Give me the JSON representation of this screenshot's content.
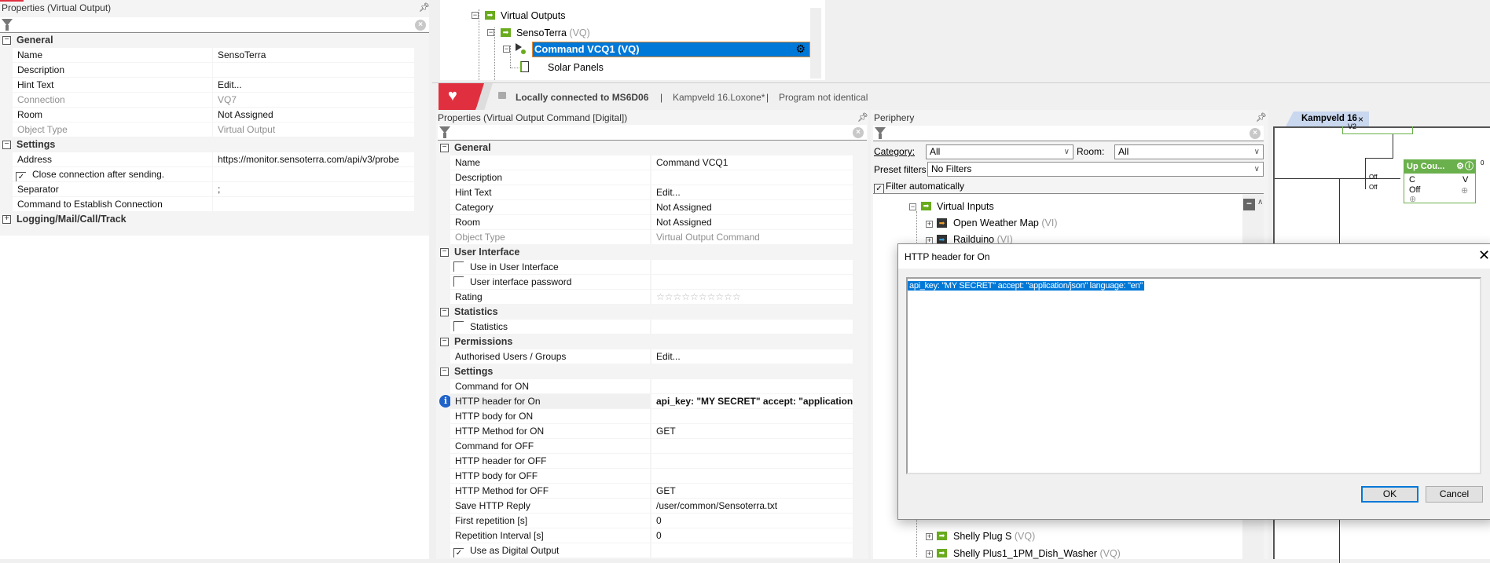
{
  "left_panel": {
    "title": "Properties (Virtual Output)",
    "sections": [
      {
        "title": "General",
        "expanded": true,
        "rows": [
          {
            "label": "Name",
            "value": "SensoTerra"
          },
          {
            "label": "Description",
            "value": ""
          },
          {
            "label": "Hint Text",
            "value": "Edit..."
          },
          {
            "label": "Connection",
            "value": "VQ7",
            "dim": true
          },
          {
            "label": "Room",
            "value": "Not Assigned"
          },
          {
            "label": "Object Type",
            "value": "Virtual Output",
            "dim": true
          }
        ]
      },
      {
        "title": "Settings",
        "expanded": true,
        "rows": [
          {
            "label": "Address",
            "value": "https://monitor.sensoterra.com/api/v3/probe"
          },
          {
            "label": "Close connection after sending.",
            "checkbox": true,
            "checked": true,
            "value": ""
          },
          {
            "label": "Separator",
            "value": ";"
          },
          {
            "label": "Command to Establish Connection",
            "value": ""
          }
        ]
      },
      {
        "title": "Logging/Mail/Call/Track",
        "expanded": false,
        "rows": []
      }
    ]
  },
  "top_tree": {
    "items": [
      {
        "label": "Virtual Outputs",
        "suffix": ""
      },
      {
        "label": "SensoTerra",
        "suffix": "(VQ)"
      },
      {
        "label": "Command VCQ1  (VQ)",
        "suffix": ""
      },
      {
        "label": "Solar Panels",
        "suffix": ""
      }
    ]
  },
  "status_bar": {
    "connection": "Locally connected to MS6D06",
    "sep": "|",
    "file": "Kampveld 16.Loxone*",
    "state": "Program not identical"
  },
  "middle_panel": {
    "title": "Properties (Virtual Output Command [Digital])",
    "sections": [
      {
        "title": "General",
        "expanded": true,
        "rows": [
          {
            "label": "Name",
            "value": "Command VCQ1"
          },
          {
            "label": "Description",
            "value": ""
          },
          {
            "label": "Hint Text",
            "value": "Edit..."
          },
          {
            "label": "Category",
            "value": "Not Assigned"
          },
          {
            "label": "Room",
            "value": "Not Assigned"
          },
          {
            "label": "Object Type",
            "value": "Virtual Output Command",
            "dim": true
          }
        ]
      },
      {
        "title": "User Interface",
        "expanded": true,
        "rows": [
          {
            "label": "Use in User Interface",
            "checkbox": true,
            "checked": false,
            "value": ""
          },
          {
            "label": "User interface password",
            "checkbox": true,
            "checked": false,
            "value": ""
          },
          {
            "label": "Rating",
            "rating": {
              "stars": 10,
              "value": 0
            }
          }
        ]
      },
      {
        "title": "Statistics",
        "expanded": true,
        "rows": [
          {
            "label": "Statistics",
            "checkbox": true,
            "checked": false,
            "value": ""
          }
        ]
      },
      {
        "title": "Permissions",
        "expanded": true,
        "rows": [
          {
            "label": "Authorised Users / Groups",
            "value": "Edit..."
          }
        ]
      },
      {
        "title": "Settings",
        "expanded": true,
        "rows": [
          {
            "label": "Command for ON",
            "value": ""
          },
          {
            "label": "HTTP header for On",
            "value": "api_key: \"MY SECRET\" accept: \"application/'...",
            "bold": true,
            "info": true,
            "highlight": true
          },
          {
            "label": "HTTP body for ON",
            "value": ""
          },
          {
            "label": "HTTP Method for ON",
            "value": "GET"
          },
          {
            "label": "Command for OFF",
            "value": ""
          },
          {
            "label": "HTTP header for OFF",
            "value": ""
          },
          {
            "label": "HTTP body for OFF",
            "value": ""
          },
          {
            "label": "HTTP Method for OFF",
            "value": "GET"
          },
          {
            "label": "Save HTTP Reply",
            "value": "/user/common/Sensoterra.txt"
          },
          {
            "label": "First repetition [s]",
            "value": "0"
          },
          {
            "label": "Repetition Interval [s]",
            "value": "0"
          },
          {
            "label": "Use as Digital Output",
            "checkbox": true,
            "checked": true,
            "value": ""
          }
        ]
      }
    ]
  },
  "periphery": {
    "title": "Periphery",
    "category_label": "Category:",
    "category_value": "All",
    "room_label": "Room:",
    "room_value": "All",
    "preset_label": "Preset filters",
    "preset_value": "No Filters",
    "filter_auto": "Filter automatically",
    "filter_auto_checked": true,
    "tree": [
      {
        "label": "Virtual Inputs",
        "suffix": ""
      },
      {
        "label": "Open Weather Map",
        "suffix": "(VI)"
      },
      {
        "label": "Railduino",
        "suffix": "(VI)"
      },
      {
        "label": "Shelly Plug S",
        "suffix": "(VQ)"
      },
      {
        "label": "Shelly Plus1_1PM_Dish_Washer",
        "suffix": "(VQ)"
      }
    ]
  },
  "canvas": {
    "tab": "Kampveld 16",
    "top_block_label": "V2",
    "block_title": "Up Cou...",
    "inputs": [
      "C",
      "Off"
    ],
    "output": "V",
    "output_value": "0",
    "wire_labels": [
      "Off",
      "Off"
    ]
  },
  "dialog": {
    "title": "HTTP header for On",
    "text": "api_key: \"MY SECRET\" accept: \"application/json\" language: \"en\"",
    "ok": "OK",
    "cancel": "Cancel"
  },
  "colors": {
    "selection": "#0078d7",
    "green": "#6aab1e",
    "brand_red": "#e0303f"
  }
}
